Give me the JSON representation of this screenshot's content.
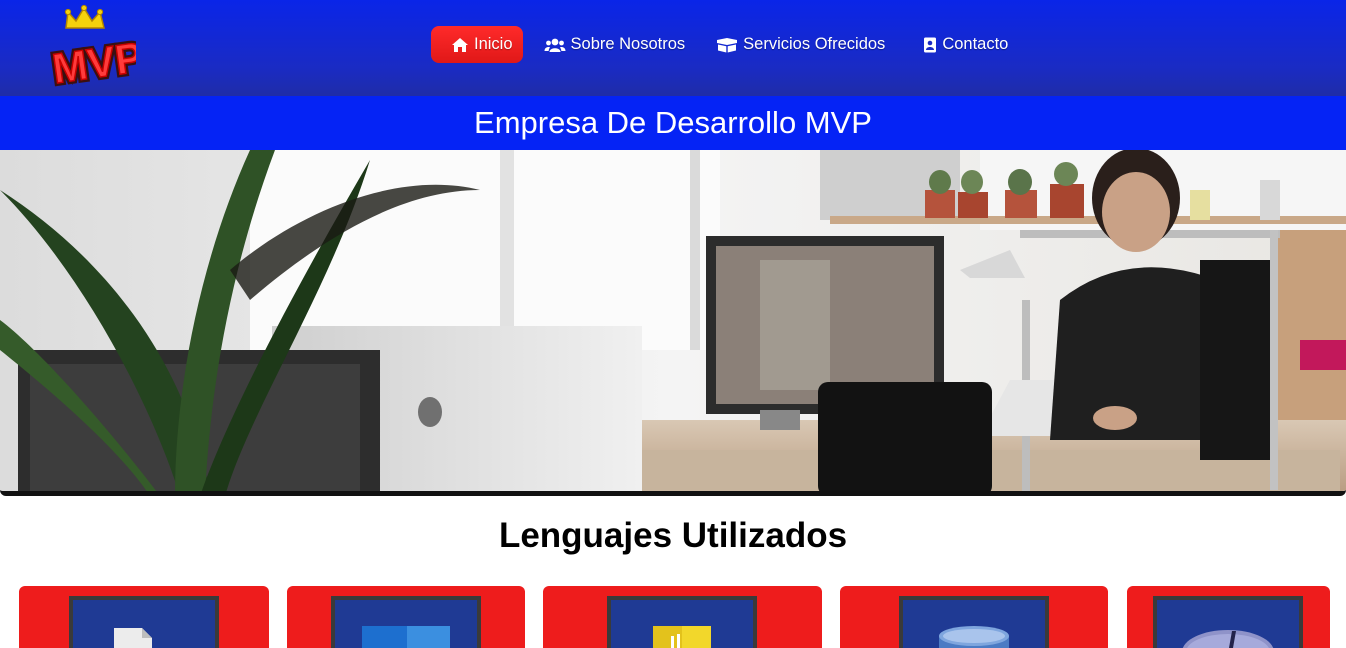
{
  "navbar": {
    "logo_text": "MVP",
    "items": [
      {
        "label": "Inicio",
        "icon": "home-icon",
        "active": true
      },
      {
        "label": "Sobre Nosotros",
        "icon": "users-icon",
        "active": false
      },
      {
        "label": "Servicios Ofrecidos",
        "icon": "box-icon",
        "active": false
      },
      {
        "label": "Contacto",
        "icon": "contact-card-icon",
        "active": false
      }
    ]
  },
  "banner": {
    "title": "Empresa De Desarrollo MVP"
  },
  "hero": {
    "image": "office-workspace-photo"
  },
  "languages": {
    "title": "Lenguajes Utilizados",
    "cards": [
      {
        "icon": "file-icon"
      },
      {
        "icon": "css-icon"
      },
      {
        "icon": "javascript-icon"
      },
      {
        "icon": "database-icon"
      },
      {
        "icon": "php-icon"
      }
    ]
  },
  "colors": {
    "navbar": "#1a2bc4",
    "banner": "#0523f5",
    "active_item": "#ff2a2a",
    "card": "#ee1c1c",
    "icon_bg": "#1f3a94"
  }
}
